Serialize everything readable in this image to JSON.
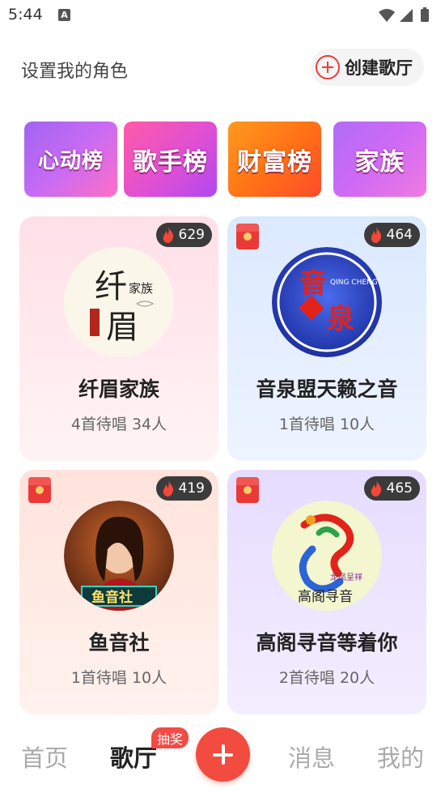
{
  "status_bar": {
    "time": "5:44",
    "notification_letter": "A"
  },
  "header": {
    "role_label": "设置我的角色",
    "create_room_label": "创建歌厅"
  },
  "banners": [
    {
      "label": "心动榜"
    },
    {
      "label": "歌手榜"
    },
    {
      "label": "财富榜"
    },
    {
      "label": "家族"
    }
  ],
  "rooms": [
    {
      "name": "纤眉家族",
      "meta": "4首待唱 34人",
      "heat": "629",
      "has_red_packet": false,
      "avatar_text": {
        "big": "纤",
        "small": "家族",
        "big2": "眉"
      }
    },
    {
      "name": "音泉盟天籁之音",
      "meta": "1首待唱 10人",
      "heat": "464",
      "has_red_packet": true,
      "avatar_text": {
        "top": "音",
        "bottom": "泉",
        "side": "QING CHENG"
      }
    },
    {
      "name": "鱼音社",
      "meta": "1首待唱 10人",
      "heat": "419",
      "has_red_packet": true,
      "avatar_text": {
        "sign": "鱼音社"
      }
    },
    {
      "name": "高阁寻音等着你",
      "meta": "2首待唱 20人",
      "heat": "465",
      "has_red_packet": true,
      "avatar_text": {
        "small": "龙凤呈祥",
        "bottom": "高阁寻音"
      }
    }
  ],
  "bottom_nav": {
    "home": "首页",
    "room": "歌厅",
    "badge": "抽奖",
    "messages": "消息",
    "me": "我的"
  },
  "colors": {
    "accent": "#f24b3f",
    "heat_bg": "#3b3b3b"
  }
}
